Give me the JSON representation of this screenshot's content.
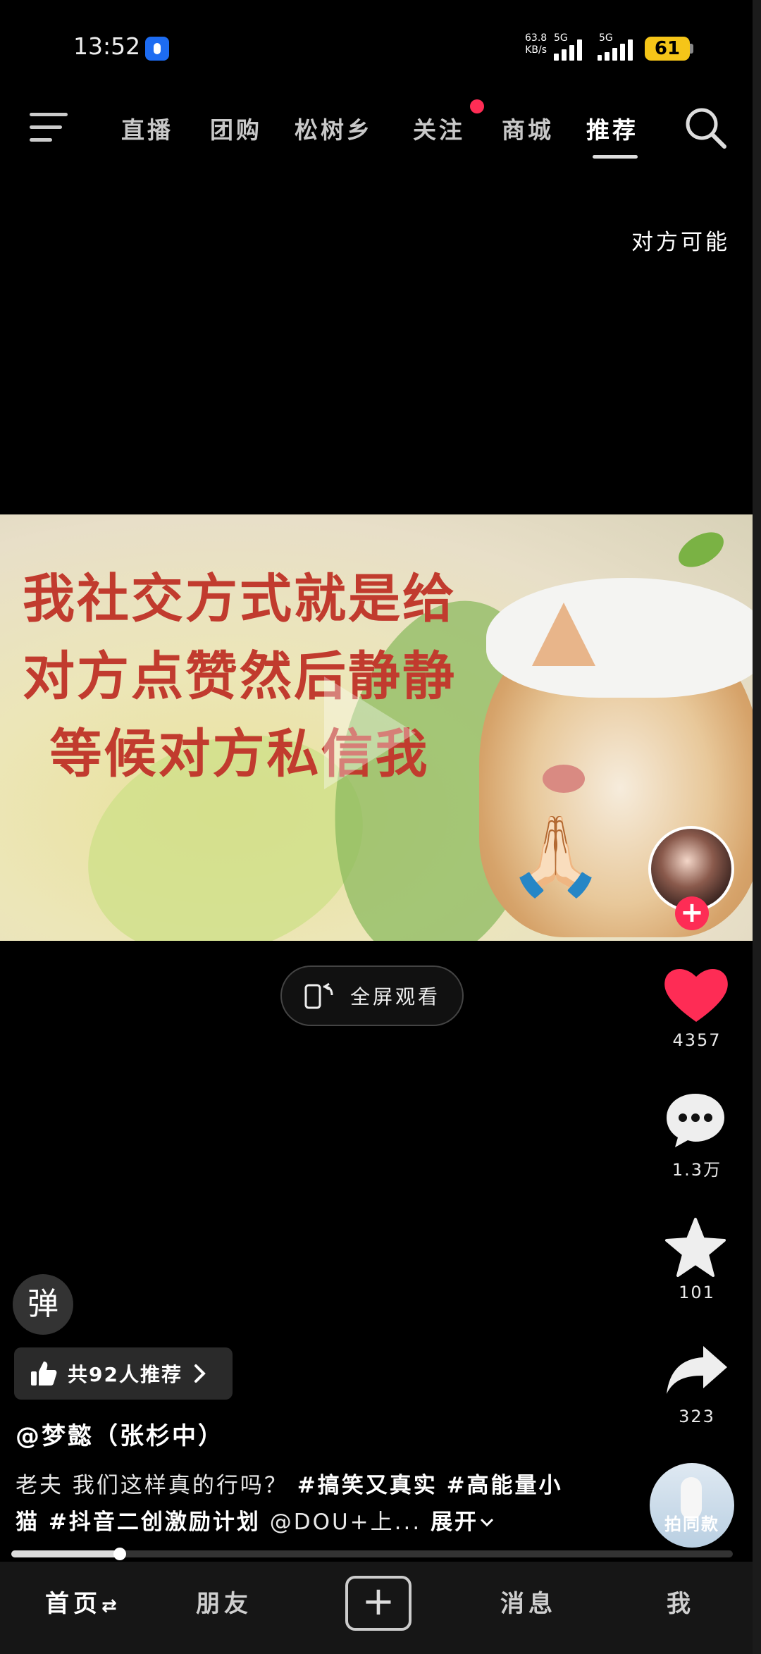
{
  "status_bar": {
    "time": "13:52",
    "net_speed_value": "63.8",
    "net_speed_unit": "KB/s",
    "network_1": "5G",
    "network_2": "5G",
    "battery": "61"
  },
  "top_nav": {
    "tabs": [
      "直播",
      "团购",
      "松树乡",
      "关注",
      "商城",
      "推荐"
    ],
    "active_tab": "推荐"
  },
  "danmu_text": "对方可能",
  "video": {
    "caption_lines": [
      "我社交方式就是给",
      "对方点赞然后静静",
      "等候对方私信我"
    ],
    "emoji": "🙏🏻"
  },
  "fullscreen_label": "全屏观看",
  "actions": {
    "like_count": "4357",
    "comment_count": "1.3万",
    "favorite_count": "101",
    "share_count": "323"
  },
  "danmu_toggle_label": "弹",
  "recommend_label": "共92人推荐",
  "author_name": "@梦懿（张杉中）",
  "description": {
    "text": "老夫 我们这样真的行吗？",
    "tags": [
      "#搞笑又真实",
      "#高能量小猫",
      "#抖音二创激励计划"
    ],
    "mention": "@DOU+上...",
    "expand_label": "展开"
  },
  "same_style_label": "拍同款",
  "playback_progress_percent": 15,
  "bottom_tabs": {
    "home": "首页",
    "friends": "朋友",
    "messages": "消息",
    "me": "我"
  },
  "colors": {
    "like": "#fe2c55",
    "follow_badge": "#fe2c55",
    "caption_red": "#c13b2e",
    "battery": "#f5c518"
  }
}
